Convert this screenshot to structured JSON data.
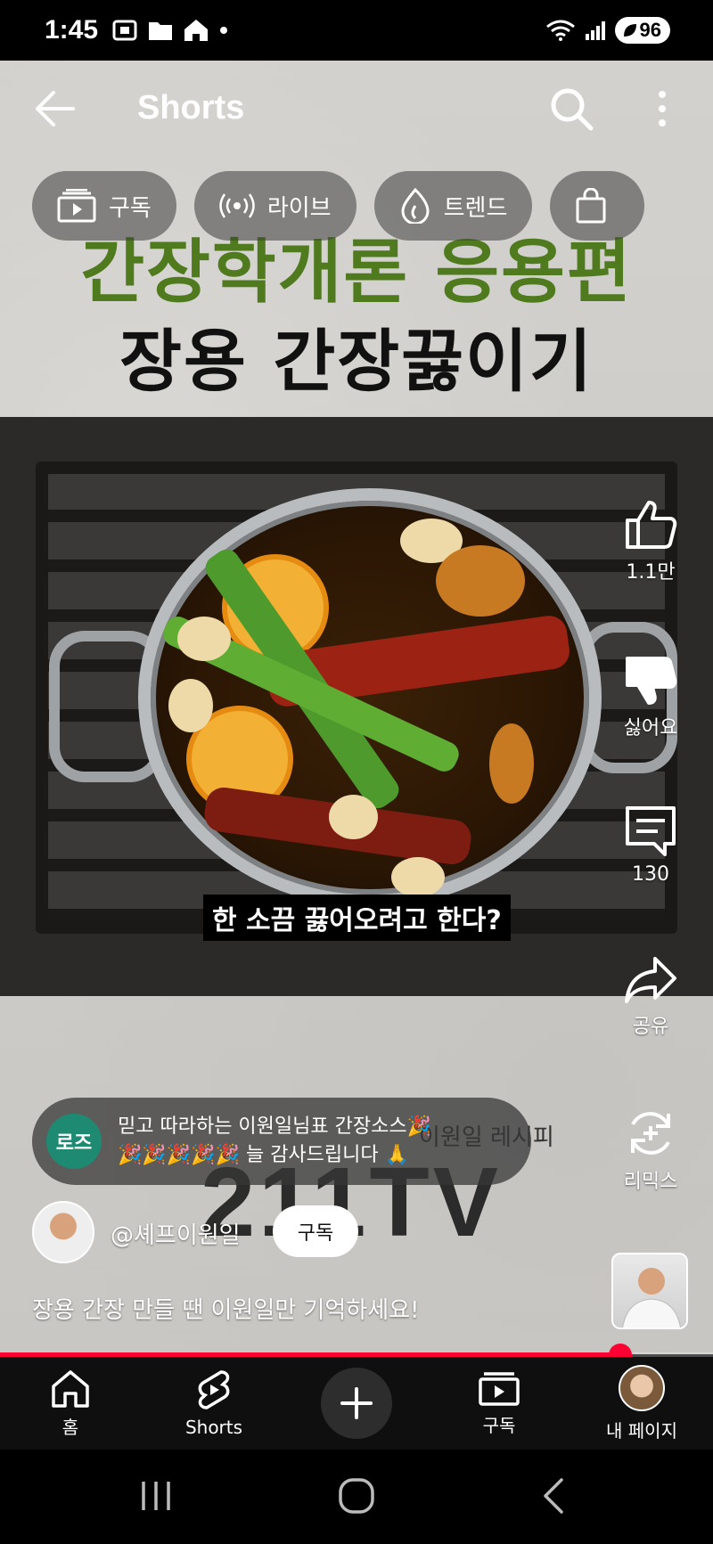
{
  "status_bar": {
    "time": "1:45",
    "battery": "96"
  },
  "header": {
    "title": "Shorts",
    "chips": [
      {
        "label": "구독",
        "icon": "subscriptions-icon"
      },
      {
        "label": "라이브",
        "icon": "live-icon"
      },
      {
        "label": "트렌드",
        "icon": "trending-icon"
      },
      {
        "label": "",
        "icon": "shopping-bag-icon"
      }
    ]
  },
  "video": {
    "title_line1": "간장학개론 응용편",
    "title_line2": "장용 간장끓이기",
    "subtitle": "한 소끔 끓어오려고 한다?",
    "watermark": "211TV",
    "watermark_sub": "이원일 레시피"
  },
  "actions": {
    "like_count": "1.1만",
    "dislike_label": "싫어요",
    "comment_count": "130",
    "share_label": "공유",
    "remix_label": "리믹스"
  },
  "comment": {
    "avatar_text": "로즈",
    "line1": "믿고 따라하는 이원일님표  간장소스🎉",
    "line2": "🎉🎉🎉🎉🎉 늘 감사드립니다 🙏"
  },
  "channel": {
    "name": "@셰프이원일",
    "subscribe_label": "구독",
    "caption": "장용 간장 만들 땐 이원일만 기억하세요!"
  },
  "playback": {
    "progress": 0.87
  },
  "bottom_nav": {
    "home": "홈",
    "shorts": "Shorts",
    "subscriptions": "구독",
    "you": "내 페이지"
  },
  "colors": {
    "accent": "#ff0033",
    "title_green": "#4f7a1e"
  }
}
